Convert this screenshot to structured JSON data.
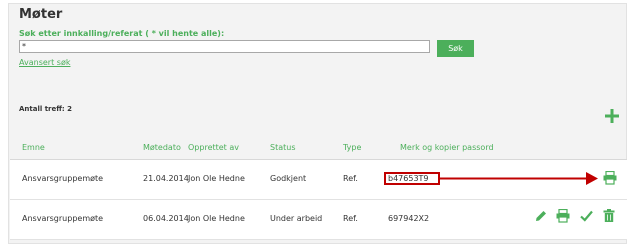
{
  "page": {
    "title": "Møter"
  },
  "search": {
    "label": "Søk etter innkalling/referat ( * vil hente alle):",
    "value": "*",
    "button_label": "Søk",
    "advanced_link": "Avansert søk"
  },
  "results": {
    "count_label": "Antall treff: 2"
  },
  "table": {
    "headers": {
      "emne": "Emne",
      "motedato": "Møtedato",
      "opprettet": "Opprettet av",
      "status": "Status",
      "type": "Type",
      "passord": "Merk og kopier passord"
    },
    "rows": [
      {
        "emne": "Ansvarsgruppemøte",
        "motedato": "21.04.2014",
        "opprettet": "Jon Ole Hedne",
        "status": "Godkjent",
        "type": "Ref.",
        "passord": "b47653T9",
        "actions": [
          "print-icon"
        ]
      },
      {
        "emne": "Ansvarsgruppemøte",
        "motedato": "06.04.2014",
        "opprettet": "Jon Ole Hedne",
        "status": "Under arbeid",
        "type": "Ref.",
        "passord": "697942X2",
        "actions": [
          "edit-icon",
          "print-icon",
          "approve-icon",
          "delete-icon"
        ]
      }
    ]
  },
  "colors": {
    "accent": "#4caf5b",
    "highlight": "#c00000",
    "panel_bg": "#f3f3f3"
  }
}
